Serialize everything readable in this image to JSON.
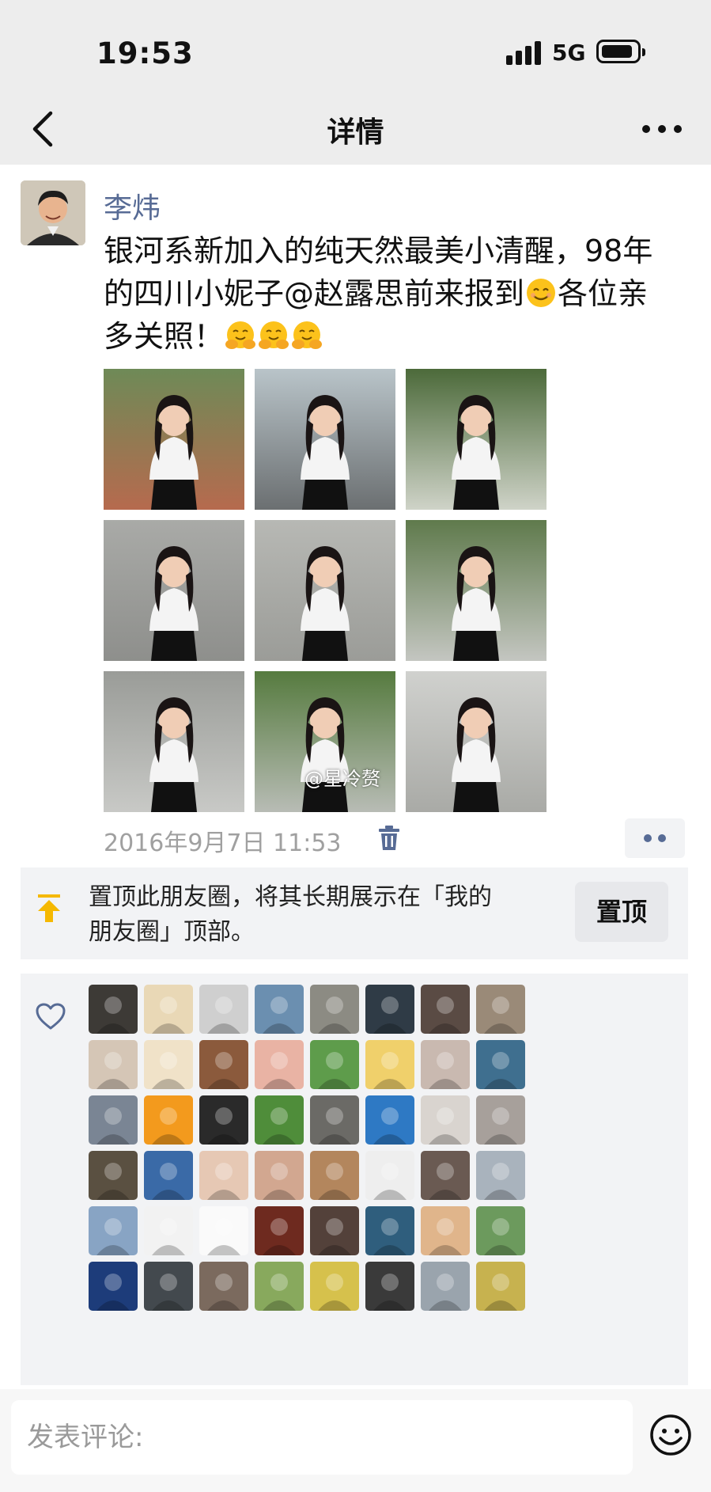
{
  "status_bar": {
    "time": "19:53",
    "network": "5G"
  },
  "nav": {
    "title": "详情"
  },
  "post": {
    "author": "李炜",
    "text_line1": "银河系新加入的纯天然最美小清醒，98年",
    "text_line2_a": "的四川小妮子",
    "mention": "@赵露思",
    "text_line2_b": "前来报到",
    "text_line2_c": "各位亲",
    "text_line3": "多关照！",
    "watermark": "@星冷赘",
    "timestamp": "2016年9月7日 11:53",
    "photo_count": 9
  },
  "pin_banner": {
    "line1": "置顶此朋友圈，将其长期展示在「我的",
    "line2": "朋友圈」顶部。",
    "button": "置顶"
  },
  "likes": {
    "count": 48
  },
  "comment": {
    "placeholder": "发表评论:"
  },
  "icons": [
    "back-arrow-icon",
    "more-icon",
    "trash-icon",
    "more-actions-icon",
    "pin-top-icon",
    "heart-icon",
    "smile-emoji-icon"
  ],
  "colors": {
    "link": "#576b95",
    "pin_arrow": "#f5b800",
    "meta_gray": "#a0a0a0"
  }
}
